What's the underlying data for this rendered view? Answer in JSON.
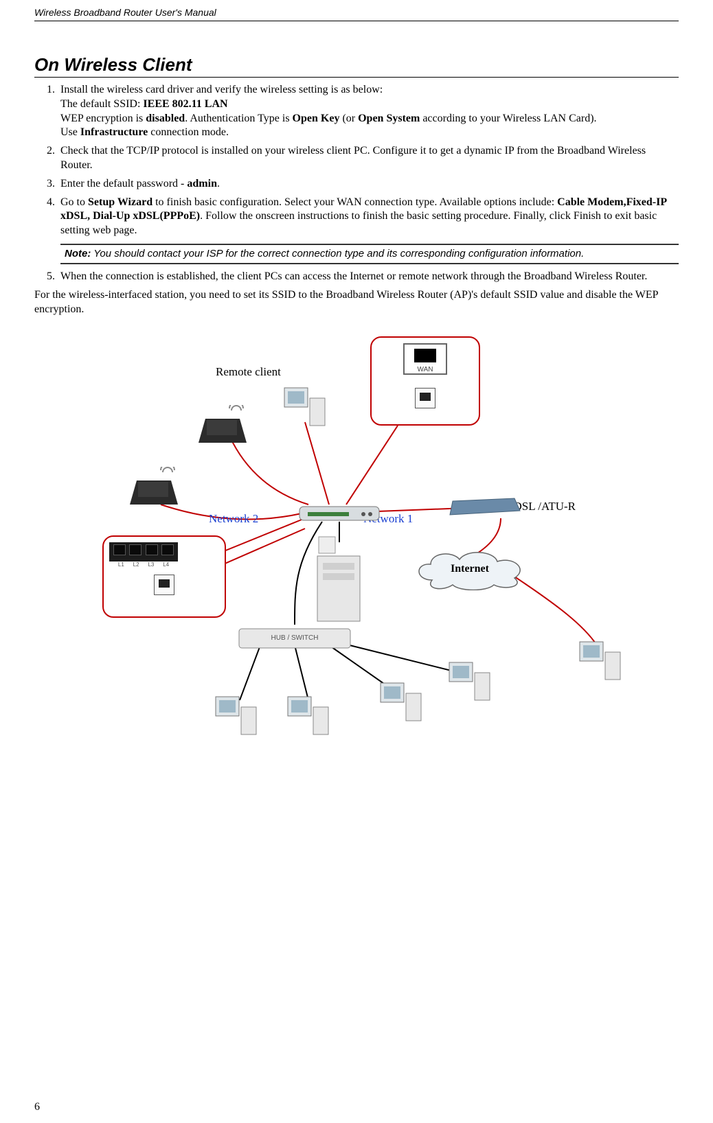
{
  "header": {
    "running_title": "Wireless Broadband Router User's Manual"
  },
  "section": {
    "title": "On Wireless Client"
  },
  "steps": {
    "s1": {
      "line1": "Install the wireless card driver and verify the wireless setting is as below:",
      "line2_prefix": "The default SSID: ",
      "line2_bold": "IEEE 802.11 LAN",
      "line3_a": "WEP encryption is ",
      "line3_b_bold": "disabled",
      "line3_c": ". Authentication Type is ",
      "line3_d_bold": "Open Key",
      "line3_e": " (or ",
      "line3_f_bold": "Open System",
      "line3_g": " according to your Wireless LAN Card).",
      "line4_a": "Use ",
      "line4_b_bold": "Infrastructure",
      "line4_c": " connection mode."
    },
    "s2": "Check that the TCP/IP protocol is installed on your wireless client PC. Configure it to get a dynamic IP from the Broadband Wireless Router.",
    "s3_a": "Enter the default password - ",
    "s3_b_bold": "admin",
    "s3_c": ".",
    "s4_a": "Go to ",
    "s4_b_bold": "Setup Wizard",
    "s4_c": " to finish basic configuration. Select your WAN connection type. Available options include: ",
    "s4_d_bold": "Cable Modem,Fixed-IP xDSL, Dial-Up xDSL(PPPoE)",
    "s4_e": ". Follow the onscreen instructions to finish the basic setting procedure. Finally, click Finish to exit basic setting web page.",
    "note_label": "Note:",
    "note_body": " You should contact your ISP for the correct connection type and its corresponding configuration information.",
    "s5": "When the connection is established, the client PCs can access the Internet or remote network through the Broadband Wireless Router."
  },
  "after_list": "For the wireless-interfaced station, you need to set its SSID to the Broadband Wireless Router (AP)'s default SSID value and disable the WEP encryption.",
  "diagram": {
    "remote_client": "Remote client",
    "network1": "Network 1",
    "network2": "Network 2",
    "xdsl": "xDSL /ATU-R",
    "internet": "Internet",
    "hub_switch": "HUB / SWITCH",
    "wan_port": "WAN",
    "lan_labels": {
      "l1": "L1",
      "l2": "L2",
      "l3": "L3",
      "l4": "L4"
    }
  },
  "page_number": "6"
}
